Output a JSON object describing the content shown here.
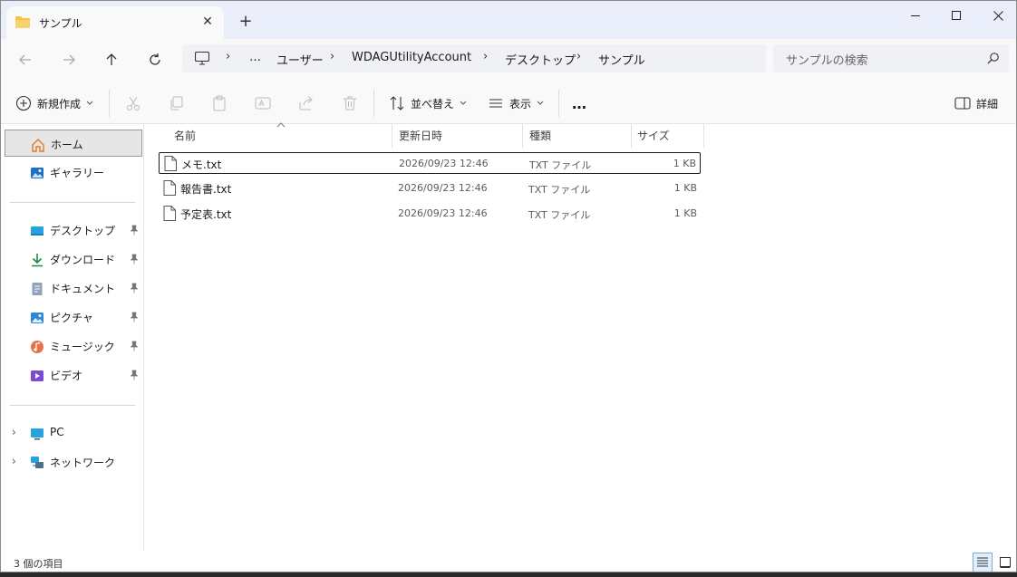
{
  "tab": {
    "title": "サンプル",
    "close": "✕",
    "new": "+"
  },
  "window_controls": {
    "minimize": "minimize",
    "maximize": "maximize",
    "close": "close"
  },
  "address": {
    "more": "…",
    "crumbs": [
      "ユーザー",
      "WDAGUtilityAccount",
      "デスクトップ",
      "サンプル"
    ],
    "separator": "›"
  },
  "search": {
    "placeholder": "サンプルの検索"
  },
  "commands": {
    "new": "新規作成",
    "sort": "並べ替え",
    "view": "表示",
    "more": "…",
    "details": "詳細"
  },
  "sidebar": {
    "quick": [
      {
        "label": "ホーム",
        "icon": "home-icon"
      },
      {
        "label": "ギャラリー",
        "icon": "gallery-icon"
      }
    ],
    "pinned": [
      {
        "label": "デスクトップ",
        "icon": "desktop-icon"
      },
      {
        "label": "ダウンロード",
        "icon": "download-icon"
      },
      {
        "label": "ドキュメント",
        "icon": "documents-icon"
      },
      {
        "label": "ピクチャ",
        "icon": "pictures-icon"
      },
      {
        "label": "ミュージック",
        "icon": "music-icon"
      },
      {
        "label": "ビデオ",
        "icon": "videos-icon"
      }
    ],
    "devices": [
      {
        "label": "PC",
        "icon": "pc-icon"
      },
      {
        "label": "ネットワーク",
        "icon": "network-icon"
      }
    ]
  },
  "columns": {
    "name": "名前",
    "modified": "更新日時",
    "type": "種類",
    "size": "サイズ"
  },
  "files": [
    {
      "name": "メモ.txt",
      "modified": "2026/09/23 12:46",
      "type": "TXT ファイル",
      "size": "1 KB"
    },
    {
      "name": "報告書.txt",
      "modified": "2026/09/23 12:46",
      "type": "TXT ファイル",
      "size": "1 KB"
    },
    {
      "name": "予定表.txt",
      "modified": "2026/09/23 12:46",
      "type": "TXT ファイル",
      "size": "1 KB"
    }
  ],
  "status": {
    "count": "3 個の項目"
  },
  "colors": {
    "titlebar": "#eaeefa",
    "folder": "#f4c144",
    "accent": "#0067c0",
    "selected": "#e6e6e6"
  }
}
